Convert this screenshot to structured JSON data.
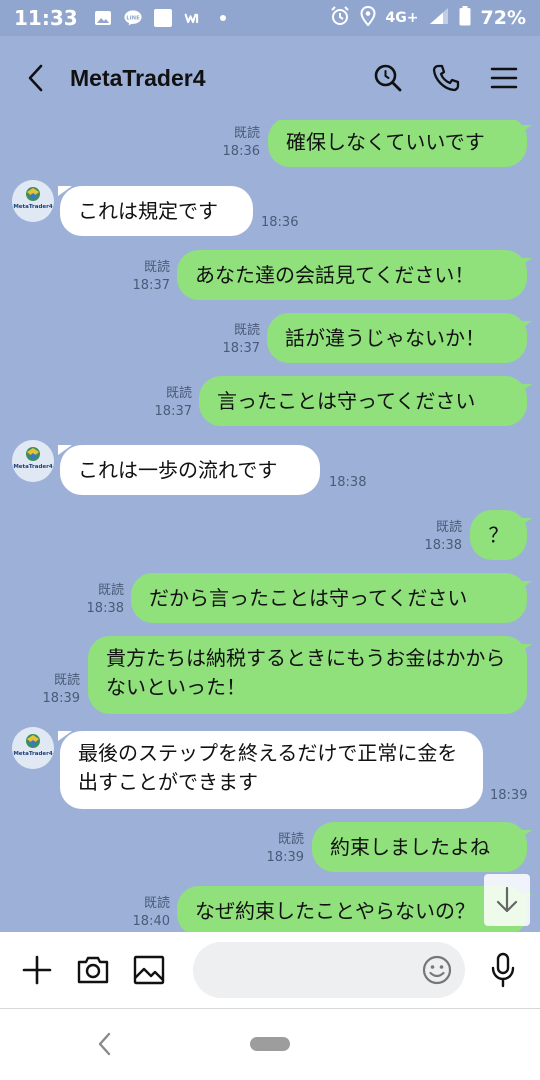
{
  "status_bar": {
    "time": "11:33",
    "network": "4G+",
    "battery": "72%"
  },
  "header": {
    "title": "MetaTrader4"
  },
  "messages": [
    {
      "direction": "out",
      "text": "確保しなくていいです",
      "read": "既読",
      "time": "18:36"
    },
    {
      "direction": "in",
      "text": "これは規定です",
      "time": "18:36"
    },
    {
      "direction": "out",
      "text": "あなた達の会話見てください！",
      "read": "既読",
      "time": "18:37"
    },
    {
      "direction": "out",
      "text": "話が違うじゃないか！",
      "read": "既読",
      "time": "18:37"
    },
    {
      "direction": "out",
      "text": "言ったことは守ってください",
      "read": "既読",
      "time": "18:37"
    },
    {
      "direction": "in",
      "text": "これは一歩の流れです",
      "time": "18:38"
    },
    {
      "direction": "out",
      "text": "？",
      "read": "既読",
      "time": "18:38"
    },
    {
      "direction": "out",
      "text": "だから言ったことは守ってください",
      "read": "既読",
      "time": "18:38"
    },
    {
      "direction": "out",
      "text": "貴方たちは納税するときにもうお金はかからないといった！",
      "read": "既読",
      "time": "18:39"
    },
    {
      "direction": "in",
      "text": "最後のステップを終えるだけで正常に金を出すことができます",
      "time": "18:39"
    },
    {
      "direction": "out",
      "text": "約束しましたよね",
      "read": "既読",
      "time": "18:39"
    },
    {
      "direction": "out",
      "text": "なぜ約束したことやらないの？",
      "read": "既読",
      "time": "18:40"
    }
  ],
  "avatar_label": "MetaTrader4",
  "icons": {
    "back": "chevron-left-icon",
    "search": "search-icon",
    "call": "phone-icon",
    "menu": "menu-icon",
    "add": "plus-icon",
    "camera": "camera-icon",
    "image": "image-icon",
    "emoji": "emoji-icon",
    "mic": "microphone-icon",
    "scroll": "arrow-down-icon"
  },
  "colors": {
    "chat_background": "#9db1d8",
    "outgoing_bubble": "#90e07c",
    "incoming_bubble": "#ffffff"
  }
}
